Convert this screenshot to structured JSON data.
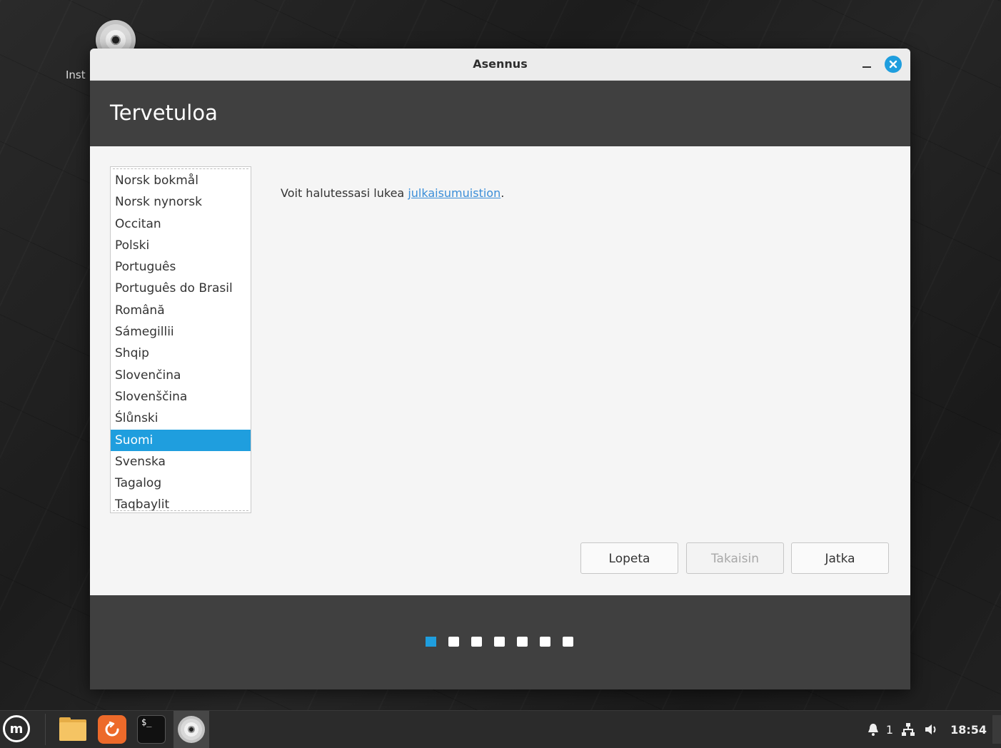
{
  "desktop": {
    "icon_label": "Inst"
  },
  "window": {
    "title": "Asennus",
    "header_title": "Tervetuloa",
    "languages": [
      "Norsk bokmål",
      "Norsk nynorsk",
      "Occitan",
      "Polski",
      "Português",
      "Português do Brasil",
      "Română",
      "Sámegillii",
      "Shqip",
      "Slovenčina",
      "Slovenščina",
      "Ślůnski",
      "Suomi",
      "Svenska",
      "Tagalog",
      "Taqbaylit"
    ],
    "selected_language": "Suomi",
    "notes_text": "Voit halutessasi lukea ",
    "notes_link": "julkaisumuistion",
    "notes_suffix": ".",
    "buttons": {
      "quit": "Lopeta",
      "back": "Takaisin",
      "next": "Jatka"
    },
    "steps_total": 7,
    "current_step": 1
  },
  "taskbar": {
    "notification_count": "1",
    "clock": "18:54"
  },
  "colors": {
    "accent": "#1f9ede",
    "header_band": "#404040",
    "link": "#3b8ed8"
  }
}
